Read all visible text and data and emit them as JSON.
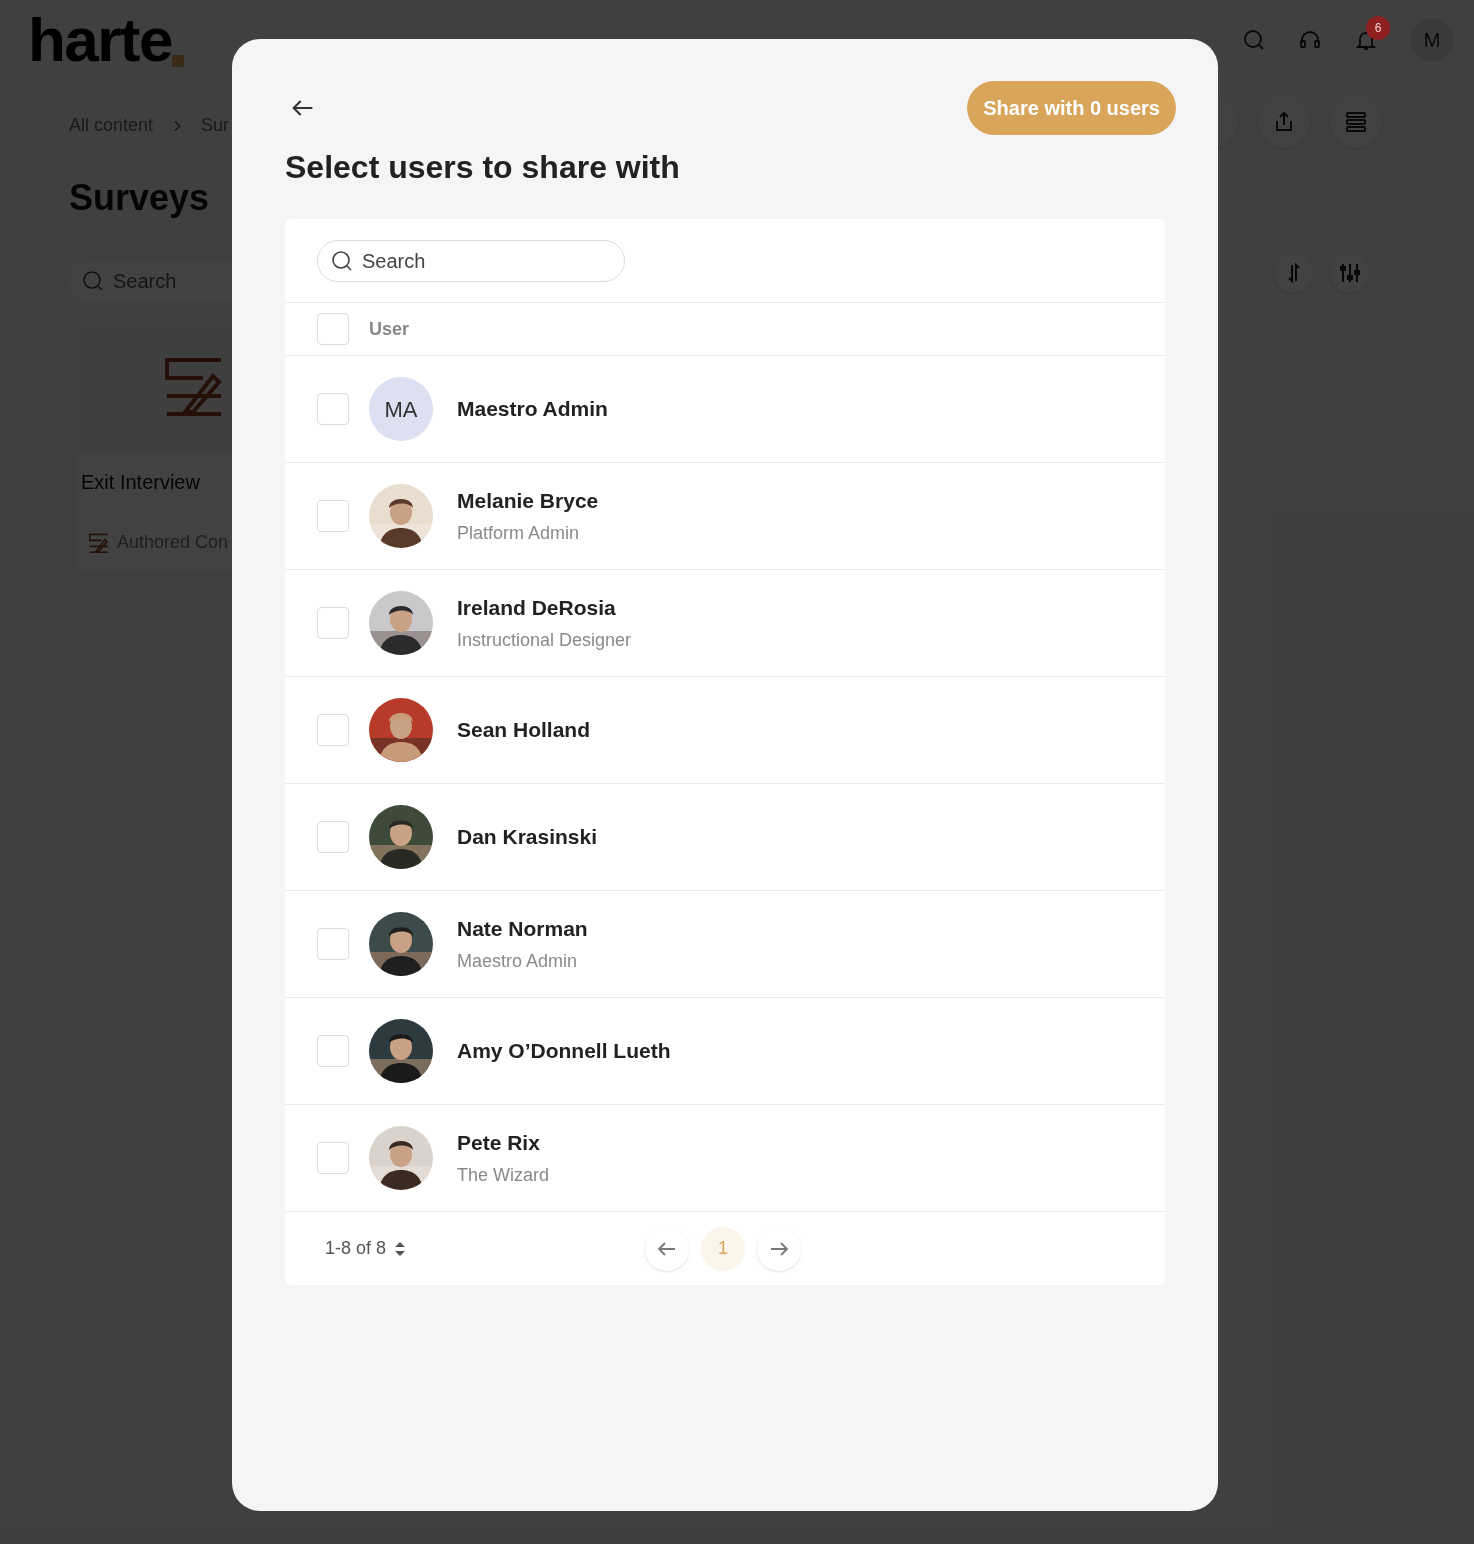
{
  "header": {
    "logo": "harte",
    "notification_count": "6",
    "account_initial": "M"
  },
  "page": {
    "breadcrumb": [
      "All content",
      "Sur"
    ],
    "title": "Surveys",
    "search": {
      "placeholder": "Search"
    },
    "card": {
      "title": "Exit Interview",
      "type": "Authored Con"
    }
  },
  "dialog": {
    "title": "Select users to share with",
    "share_button": "Share with 0 users",
    "search": {
      "placeholder": "Search"
    },
    "column": "User",
    "header_checked": false,
    "users": [
      {
        "name": "Maestro Admin",
        "avatar": {
          "kind": "initials",
          "text": "MA"
        },
        "selected": false
      },
      {
        "name": "Melanie Bryce",
        "role": "Platform Admin",
        "selected": false
      },
      {
        "name": "Ireland DeRosia",
        "role": "Instructional Designer",
        "selected": false
      },
      {
        "name": "Sean Holland",
        "selected": false
      },
      {
        "name": "Dan Krasinski",
        "selected": false
      },
      {
        "name": "Nate Norman",
        "role": "Maestro Admin",
        "selected": false
      },
      {
        "name": "Amy O’Donnell Lueth",
        "selected": false
      },
      {
        "name": "Pete Rix",
        "role": "The Wizard",
        "selected": false
      }
    ],
    "pagination": {
      "range": "1-8 of 8",
      "pages": [
        {
          "label": "1",
          "selected": true
        }
      ]
    }
  }
}
